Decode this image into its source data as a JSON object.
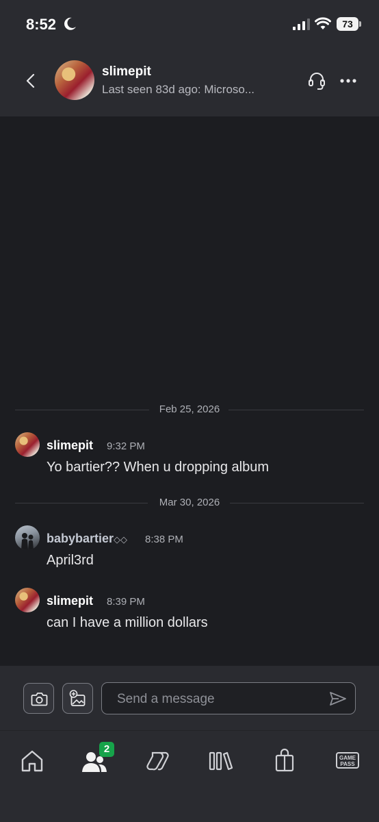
{
  "status_bar": {
    "time": "8:52",
    "battery": "73",
    "icons": [
      "moon-icon",
      "signal-icon",
      "wifi-icon",
      "battery-icon"
    ]
  },
  "header": {
    "name": "slimepit",
    "subtitle": "Last seen 83d ago: Microso..."
  },
  "conversation": {
    "separators": [
      {
        "label": "Feb 25, 2026"
      },
      {
        "label": "Mar 30, 2026"
      }
    ],
    "messages": [
      {
        "author": "slimepit",
        "time": "9:32 PM",
        "text": "Yo bartier?? When u dropping album"
      },
      {
        "author": "babybartier",
        "author_suffix": "◇◇",
        "time": "8:38 PM",
        "text": "April3rd"
      },
      {
        "author": "slimepit",
        "time": "8:39 PM",
        "text": "can I have a million dollars"
      }
    ]
  },
  "composer": {
    "placeholder": "Send a message",
    "icons": [
      "camera-icon",
      "add-image-icon",
      "send-icon"
    ]
  },
  "bottom_nav": {
    "items": [
      "home-icon",
      "friends-icon",
      "collections-icon",
      "library-icon",
      "store-icon",
      "game-pass-icon"
    ],
    "friends_badge": "2",
    "game_pass_label_line1": "GAME",
    "game_pass_label_line2": "PASS"
  },
  "colors": {
    "background": "#1c1d21",
    "panel": "#2a2b30",
    "badge": "#16a34a"
  }
}
